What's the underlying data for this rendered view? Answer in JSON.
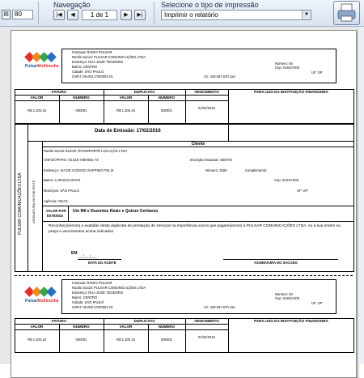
{
  "toolbar": {
    "zoom_value": "80",
    "navigation_label": "Navegação",
    "page_indicator": "1 de 1",
    "print_type_label": "Selecione o tipo de impressão",
    "print_type_value": "Imprimir o relatório",
    "nav_buttons": {
      "first": "|◀",
      "prev": "◀",
      "next": "▶",
      "last": "▶|"
    }
  },
  "logo": {
    "brand": "Pulsar",
    "brand2": "Multimedia"
  },
  "issuer": {
    "fantasia": "Fantasia: RÁDIO PULSAR",
    "razao": "Razão Social: PULSAR COMUNICAÇÕES LTDA",
    "endereco": "Endereço: RUA JOSÉ TEODORO",
    "bairro": "Bairro: CENTRO",
    "cidade": "Cidade: SÃO PAULO",
    "cnpj": "CNPJ: 05.053.275/0001-01",
    "numero": "Número: 84",
    "cep": "Cep: 01810-000",
    "uf": "UF: SP",
    "ie": "I.E: 440.067.670.116"
  },
  "table_headers": {
    "fatura": "FATURA",
    "duplicata": "DUPLICATA",
    "vencimento": "VENCIMENTO",
    "uso": "PARA USO DA INSTITUIÇÃO FINANCEIRA",
    "valor": "VALOR",
    "numero": "NÚMERO"
  },
  "values": {
    "fatura_valor": "R$ 1.200,15",
    "fatura_numero": "000001",
    "dup_valor": "R$ 1.200,15",
    "dup_numero": "000001",
    "vencimento": "01/02/2016"
  },
  "emissao": "Data de Emissão: 17/02/2016",
  "cliente": {
    "title": "Cliente",
    "razao": "Razão Social: ELEVE TRANSPORTE LOCAÇÃO LTDA",
    "cnpj": "CNPJ/CPF/RG: 04.818.748/0001-74",
    "ie": "Inscrição Estadual: ISENTO",
    "endereco": "Endereço: VIA DE ACESSO VIAPPINO POLIS",
    "numero": "Número: 2500",
    "complemento": "Complemento:",
    "bairro": "Bairro: LARANJA DOCE",
    "cep": "Cep: 01310-000",
    "municipio": "Município: SÃO PAULO",
    "uf": "UF: SP",
    "agencia": "Agência: ADIAS"
  },
  "side_labels": {
    "outer": "PULSAR COMUNICAÇÕES LTDA",
    "inner": "ASSINATURA DO EMITENTE"
  },
  "extenso": {
    "label1": "VALOR POR",
    "label2": "EXTENSO",
    "text": "Um Mil e Duzentos Reais e Quinze Centavos"
  },
  "declaration": "Reconheço(emos) a exatidão desta duplicata de prestação de serviços na importância acima que pagarei(emos) à PULSAR COMUNICAÇÕES LTDA, ou à sua ordem na praça e vencimentos acima indicados.",
  "signature": {
    "em": "EM",
    "date_line": "___/___/___",
    "date_caption": "DATA DO ACEITE",
    "signer": "ASSINATURA DO SACADO"
  },
  "colors": {
    "logo": [
      "#e0302c",
      "#f08a1c",
      "#3aa34a",
      "#2b6fbf"
    ]
  }
}
